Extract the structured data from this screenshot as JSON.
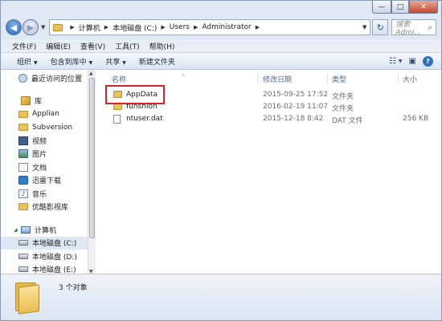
{
  "window": {
    "caption_minimize": "—",
    "caption_maximize": "□",
    "caption_close": "✕"
  },
  "address": {
    "back_icon": "back-arrow-icon",
    "forward_icon": "forward-arrow-icon",
    "breadcrumb": [
      "计算机",
      "本地磁盘 (C:)",
      "Users",
      "Administrator"
    ],
    "search_placeholder": "搜索 Admi..."
  },
  "menu": [
    "文件(F)",
    "编辑(E)",
    "查看(V)",
    "工具(T)",
    "帮助(H)"
  ],
  "toolbar": {
    "organize": "组织",
    "include_library": "包含到库中",
    "share": "共享",
    "new_folder": "新建文件夹"
  },
  "nav": {
    "recent": "最近访问的位置",
    "libraries": "库",
    "library_items": [
      "Applian",
      "Subversion",
      "视频",
      "图片",
      "文档",
      "迅雷下载",
      "音乐",
      "优酷影视库"
    ],
    "computer": "计算机",
    "drives": [
      "本地磁盘 (C:)",
      "本地磁盘 (D:)",
      "本地磁盘 (E:)"
    ]
  },
  "columns": {
    "name": "名称",
    "modified": "修改日期",
    "type": "类型",
    "size": "大小"
  },
  "files": [
    {
      "name": "AppData",
      "modified": "2015-09-25 17:52",
      "type": "文件夹",
      "size": "",
      "icon": "folder-icon"
    },
    {
      "name": "funshion",
      "modified": "2016-02-19 11:07",
      "type": "文件夹",
      "size": "",
      "icon": "folder-icon"
    },
    {
      "name": "ntuser.dat",
      "modified": "2015-12-18 8:42",
      "type": "DAT 文件",
      "size": "256 KB",
      "icon": "file-icon"
    }
  ],
  "details": {
    "item_count": "3 个对象"
  },
  "colors": {
    "highlight": "#d8232a",
    "accent": "#2a63b6"
  }
}
